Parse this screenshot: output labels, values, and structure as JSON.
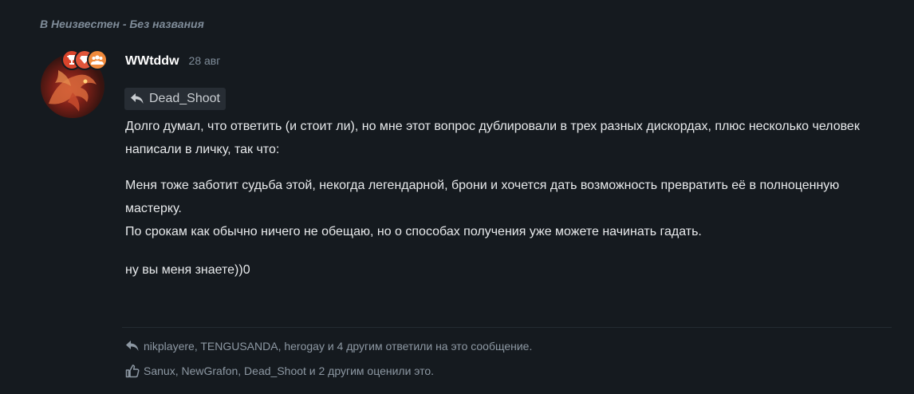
{
  "breadcrumb": "В Неизвестен - Без названия",
  "post": {
    "author": "WWtddw",
    "date": "28 авг",
    "quoted_user": "Dead_Shoot",
    "paragraphs": [
      "Долго думал, что ответить (и стоит ли), но мне этот вопрос дублировали в трех разных дискордах, плюс несколько человек написали в личку, так что:",
      "Меня тоже заботит судьба этой, некогда легендарной, брони и хочется дать возможность превратить её в полноценную мастерку.",
      "По срокам как обычно ничего не обещаю, но о способах получения уже можете начинать гадать.",
      "ну вы меня знаете))0"
    ],
    "replies_text": "nikplayere, TENGUSANDA, herogay и 4 другим ответили на это сообщение.",
    "likes_text": "Sanux, NewGrafon, Dead_Shoot и 2 другим оценили это."
  },
  "icons": {
    "badge1": "trophy-icon",
    "badge2": "diamond-icon",
    "badge3": "group-icon",
    "quote": "reply-arrow-icon",
    "reply": "reply-arrow-icon",
    "like": "thumbs-up-icon"
  },
  "colors": {
    "background": "#151a1f",
    "badge_red": "#d9442b",
    "badge_orange": "#f08a3c",
    "muted_text": "#7f8c99"
  }
}
